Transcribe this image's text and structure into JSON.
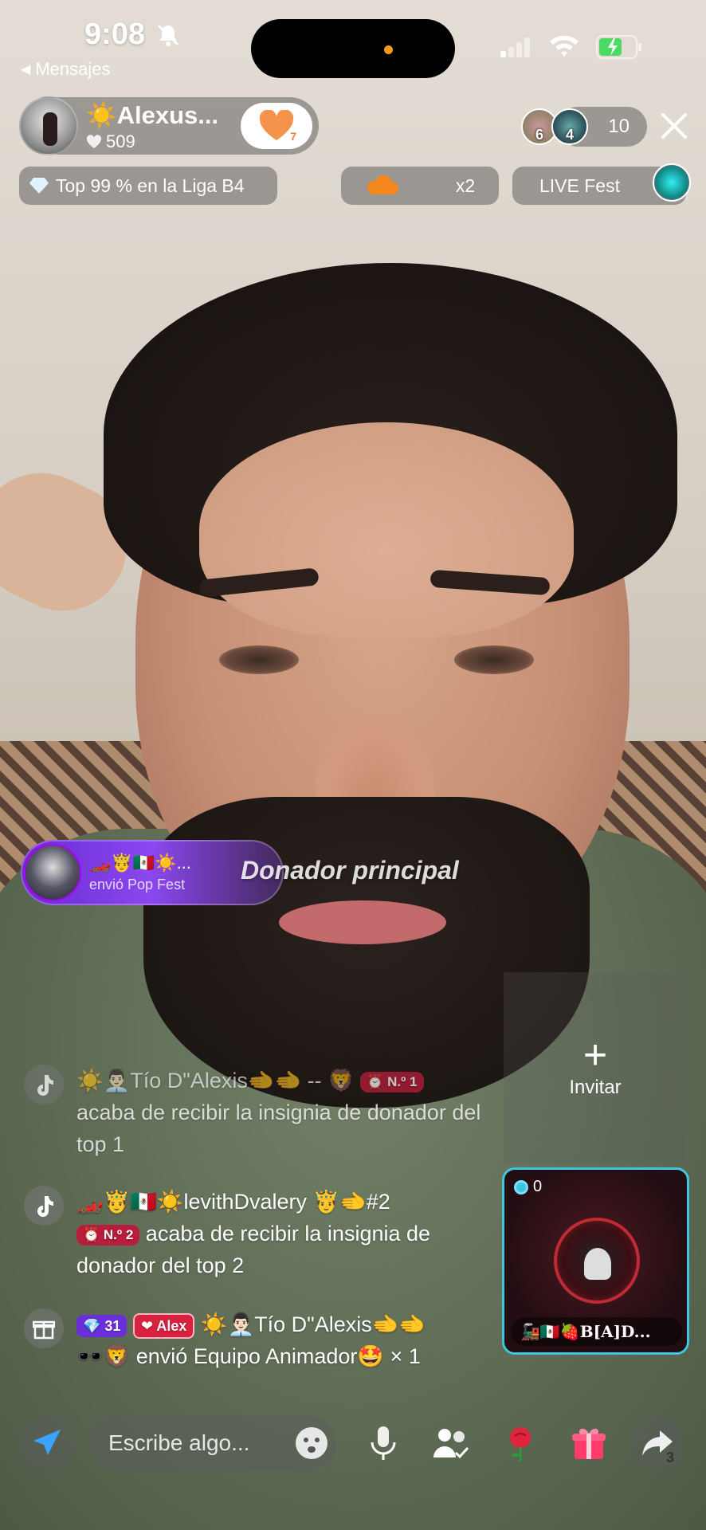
{
  "status_bar": {
    "time": "9:08",
    "back_label": "Mensajes"
  },
  "host": {
    "name": "☀️Alexus...",
    "likes": "509",
    "follow_badge": "7"
  },
  "viewers": {
    "avatar_1_badge": "6",
    "avatar_2_badge": "4",
    "count": "10"
  },
  "pills": {
    "league": "Top 99 % en la Liga B4",
    "multiplier": "x2",
    "fest": "LIVE Fest"
  },
  "top_donor": {
    "emojis": "🏎️🤴🇲🇽☀️...",
    "action": "envió Pop Fest",
    "title": "Donador principal"
  },
  "invite": {
    "plus": "+",
    "label": "Invitar"
  },
  "guest": {
    "score": "0",
    "name": "🚂🇲🇽🍓B[A]D..."
  },
  "chat": [
    {
      "head": "☀️👨🏻‍💼Tío D\"Alexis🫲🫲 -- 🦁",
      "badge": "⏰ N.º 1",
      "text": "acaba de recibir la insignia de donador del top 1"
    },
    {
      "head": "🏎️🤴🇲🇽☀️levithDvalery 🤴🫲#2",
      "badge": "⏰ N.º 2",
      "text": "acaba de recibir la insignia de donador del top 2"
    },
    {
      "level_badge": "💎 31",
      "team_badge": "❤ Alex",
      "head": "☀️👨🏻‍💼Tío D\"Alexis🫲🫲",
      "text": "🕶️🦁 envió Equipo Animador🤩 × 1"
    }
  ],
  "bottom": {
    "placeholder": "Escribe algo...",
    "share_count": "3"
  },
  "colors": {
    "accent_cyan": "#3ec6e0",
    "donor_purple": "#8b47f0",
    "rank_red": "#b81d3b",
    "follow_orange": "#f07a3c"
  },
  "icons": [
    "mute-icon",
    "signal-icon",
    "wifi-icon",
    "battery-icon",
    "heart-icon",
    "close-icon",
    "diamond-icon",
    "paper-plane-icon",
    "face-icon",
    "mic-icon",
    "guests-icon",
    "rose-icon",
    "gift-icon",
    "share-icon",
    "tiktok-icon"
  ]
}
